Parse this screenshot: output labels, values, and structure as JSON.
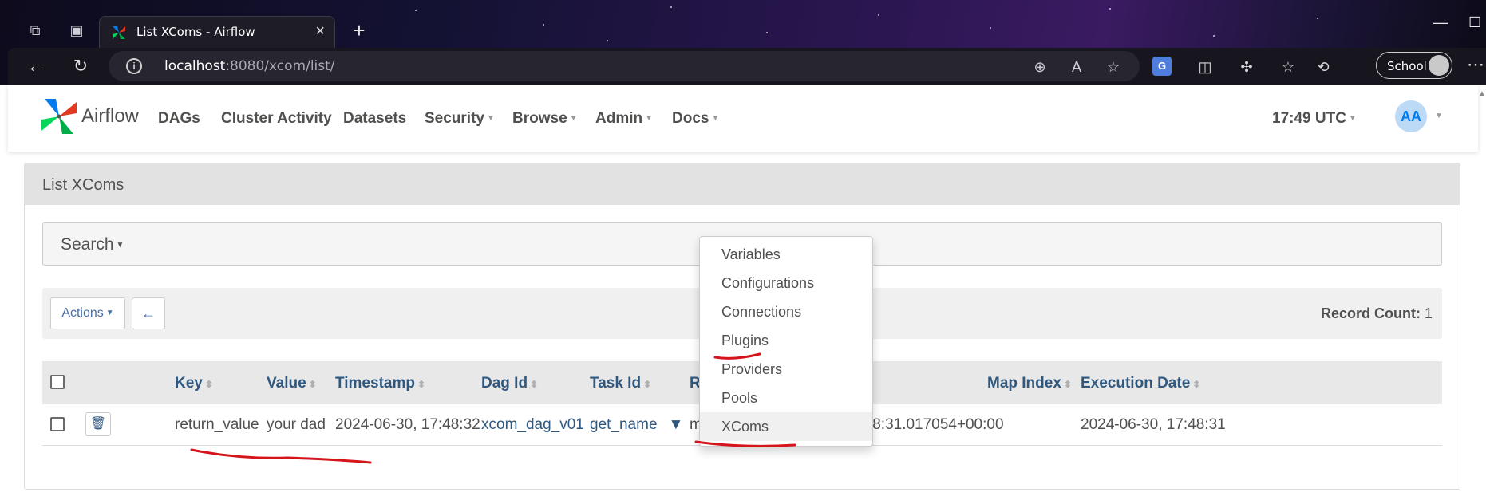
{
  "browser": {
    "tab_title": "List XComs - Airflow",
    "url_host": "localhost",
    "url_rest": ":8080/xcom/list/",
    "profile_label": "School"
  },
  "airflow": {
    "brand": "Airflow",
    "nav": {
      "dags": "DAGs",
      "cluster_activity": "Cluster Activity",
      "datasets": "Datasets",
      "security": "Security",
      "browse": "Browse",
      "admin": "Admin",
      "docs": "Docs"
    },
    "clock": "17:49 UTC",
    "user_initials": "AA",
    "admin_menu": {
      "items": [
        "Variables",
        "Configurations",
        "Connections",
        "Plugins",
        "Providers",
        "Pools",
        "XComs"
      ],
      "active": "XComs"
    },
    "panel_title": "List XComs",
    "search_label": "Search",
    "actions_label": "Actions",
    "record_count_label": "Record Count:",
    "record_count": "1",
    "table": {
      "headers": {
        "key": "Key",
        "value": "Value",
        "timestamp": "Timestamp",
        "dag_id": "Dag Id",
        "task_id": "Task Id",
        "run_id": "Run Id",
        "map_index": "Map Index",
        "execution_date": "Execution Date"
      },
      "rows": [
        {
          "key": "return_value",
          "value": "your dad",
          "timestamp": "2024-06-30, 17:48:32",
          "dag_id": "xcom_dag_v01",
          "task_id": "get_name",
          "run_id": "manual__2024-06-30T17:48:31.017054+00:00",
          "map_index": "",
          "execution_date": "2024-06-30, 17:48:31"
        }
      ]
    }
  },
  "colors": {
    "link": "#30587f",
    "annotation": "#d4161c",
    "avatar_bg": "#bcd9f5",
    "avatar_fg": "#017cee"
  }
}
